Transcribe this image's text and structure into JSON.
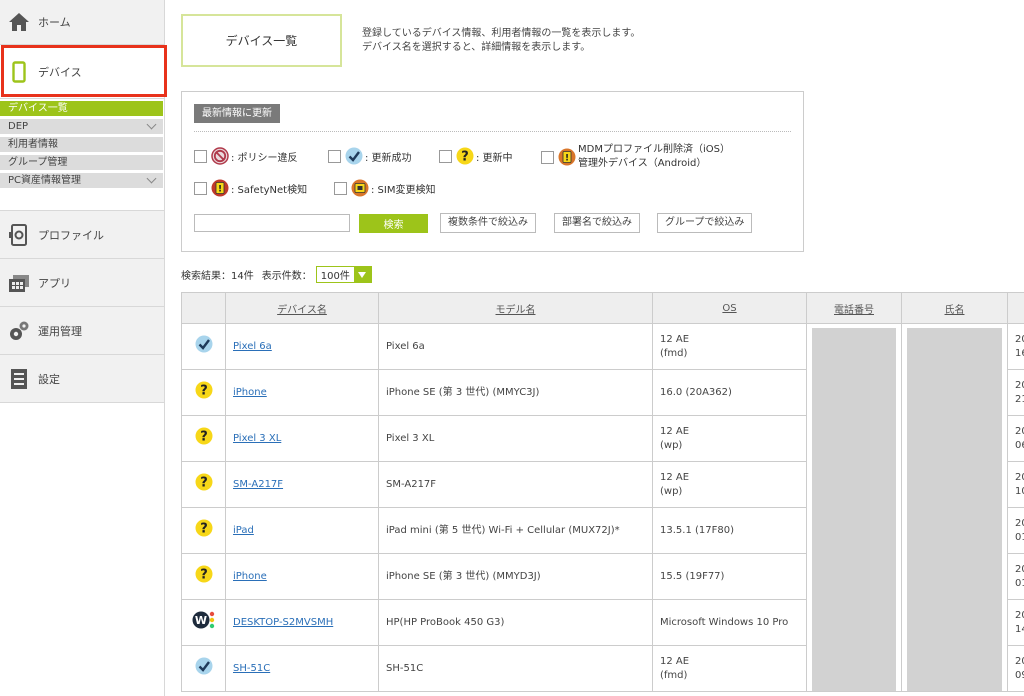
{
  "sidebar": {
    "home": {
      "label": "ホーム",
      "icon": "home-icon"
    },
    "device": {
      "label": "デバイス",
      "icon": "smartphone-icon"
    },
    "sub_items": [
      {
        "label": "デバイス一覧",
        "active": true
      },
      {
        "label": "DEP",
        "expandable": true
      },
      {
        "label": "利用者情報"
      },
      {
        "label": "グループ管理"
      },
      {
        "label": "PC資産情報管理",
        "expandable": true
      }
    ],
    "profile": {
      "label": "プロファイル",
      "icon": "profile-icon"
    },
    "app": {
      "label": "アプリ",
      "icon": "app-icon"
    },
    "ops": {
      "label": "運用管理",
      "icon": "gears-icon"
    },
    "settings": {
      "label": "設定",
      "icon": "settings-icon"
    }
  },
  "page": {
    "title": "デバイス一覧",
    "desc_line1": "登録しているデバイス情報、利用者情報の一覧を表示します。",
    "desc_line2": "デバイス名を選択すると、詳細情報を表示します。"
  },
  "filter": {
    "refresh_label": "最新情報に更新",
    "statuses": [
      {
        "label": ": ポリシー違反",
        "icon": "policy-violation-icon"
      },
      {
        "label": ": 更新成功",
        "icon": "update-success-icon"
      },
      {
        "label": ": 更新中",
        "icon": "updating-icon"
      },
      {
        "label1": "MDMプロファイル削除済（iOS）",
        "label2": "管理外デバイス（Android）",
        "icon": "mdm-removed-icon"
      },
      {
        "label": ": SafetyNet検知",
        "icon": "safetynet-icon"
      },
      {
        "label": ": SIM変更検知",
        "icon": "sim-change-icon"
      }
    ],
    "search_placeholder": "",
    "search_label": "検索",
    "buttons": [
      "複数条件で絞込み",
      "部署名で絞込み",
      "グループで絞込み"
    ]
  },
  "results": {
    "count_label": "検索結果：14件",
    "per_page_label": "表示件数：",
    "per_page_value": "100件"
  },
  "table": {
    "headers": [
      "",
      "デバイス名",
      "モデル名",
      "OS",
      "電話番号",
      "氏名",
      ""
    ],
    "rows": [
      {
        "status": "success",
        "name": "Pixel 6a",
        "model": "Pixel 6a",
        "os1": "12 AE",
        "os2": "(fmd)",
        "extra1": "20",
        "extra2": "16"
      },
      {
        "status": "updating",
        "name": "iPhone",
        "model": "iPhone SE (第 3 世代) (MMYC3J)",
        "os1": "16.0 (20A362)",
        "os2": "",
        "extra1": "20",
        "extra2": "21"
      },
      {
        "status": "updating",
        "name": "Pixel 3 XL",
        "model": "Pixel 3 XL",
        "os1": "12 AE",
        "os2": "(wp)",
        "extra1": "20",
        "extra2": "06"
      },
      {
        "status": "updating",
        "name": "SM-A217F",
        "model": "SM-A217F",
        "os1": "12 AE",
        "os2": "(wp)",
        "extra1": "20",
        "extra2": "10"
      },
      {
        "status": "updating",
        "name": "iPad",
        "model": "iPad mini (第 5 世代) Wi-Fi + Cellular (MUX72J)*",
        "os1": "13.5.1 (17F80)",
        "os2": "",
        "extra1": "20",
        "extra2": "01"
      },
      {
        "status": "updating",
        "name": "iPhone",
        "model": "iPhone SE (第 3 世代) (MMYD3J)",
        "os1": "15.5 (19F77)",
        "os2": "",
        "extra1": "20",
        "extra2": "01"
      },
      {
        "status": "windows",
        "name": "DESKTOP-S2MVSMH",
        "model": "HP(HP ProBook 450 G3)",
        "os1": "Microsoft Windows 10 Pro",
        "os2": "",
        "extra1": "20",
        "extra2": "14"
      },
      {
        "status": "success",
        "name": "SH-51C",
        "model": "SH-51C",
        "os1": "12 AE",
        "os2": "(fmd)",
        "extra1": "20",
        "extra2": "09"
      }
    ]
  },
  "colors": {
    "accent_green": "#9dc41a",
    "highlight_red": "#e8321b",
    "link_blue": "#2a6fb8"
  }
}
